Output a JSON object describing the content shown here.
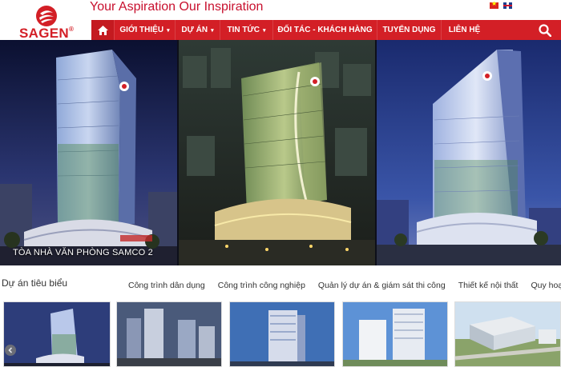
{
  "brand": {
    "name": "SAGEN",
    "registered": "®",
    "tagline": "Your Aspiration Our Inspiration",
    "accent_color": "#d31f26"
  },
  "languages": [
    {
      "code": "vi",
      "icon": "vietnam-flag-icon"
    },
    {
      "code": "en",
      "icon": "uk-flag-icon"
    }
  ],
  "nav": {
    "home_icon": "home-icon",
    "items": [
      {
        "label": "GIỚI THIỆU",
        "has_dropdown": true
      },
      {
        "label": "DỰ ÁN",
        "has_dropdown": true
      },
      {
        "label": "TIN TỨC",
        "has_dropdown": true
      },
      {
        "label": "ĐỐI TÁC - KHÁCH HÀNG",
        "has_dropdown": false
      },
      {
        "label": "TUYỂN DỤNG",
        "has_dropdown": false
      },
      {
        "label": "LIÊN HỆ",
        "has_dropdown": false
      }
    ],
    "search_icon": "search-icon",
    "caret": "▾"
  },
  "hero": {
    "caption": "TÒA NHÀ VĂN PHÒNG SAMCO 2"
  },
  "featured": {
    "title": "Dự án tiêu biểu",
    "tabs": [
      "Công trình dân dụng",
      "Công trình công nghiệp",
      "Quản lý dự án & giám sát thi công",
      "Thiết kế nội thất",
      "Quy hoạch"
    ]
  }
}
